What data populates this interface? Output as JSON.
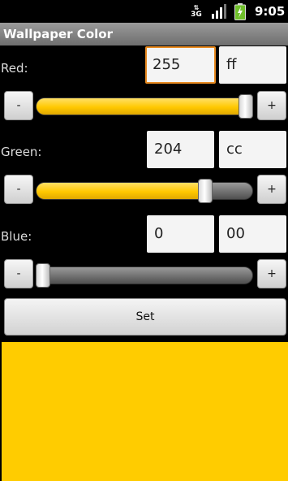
{
  "status_bar": {
    "network": "3G",
    "time": "9:05"
  },
  "app": {
    "title": "Wallpaper Color"
  },
  "red": {
    "label": "Red:",
    "decimal": "255",
    "hex": "ff",
    "minus": "-",
    "plus": "+",
    "level": 255
  },
  "green": {
    "label": "Green:",
    "decimal": "204",
    "hex": "cc",
    "minus": "-",
    "plus": "+",
    "level": 204
  },
  "blue": {
    "label": "Blue:",
    "decimal": "0",
    "hex": "00",
    "minus": "-",
    "plus": "+",
    "level": 0
  },
  "set_label": "Set",
  "colors": {
    "preview": "#ffcc00",
    "accent": "#e88a20",
    "slider_fill": "#ffc800"
  }
}
